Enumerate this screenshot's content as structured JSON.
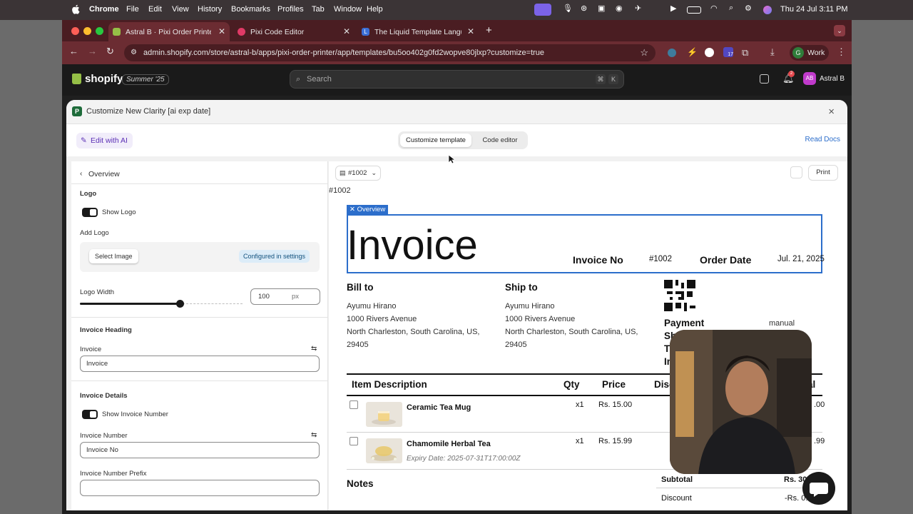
{
  "menubar": {
    "app": "Chrome",
    "items": [
      "File",
      "Edit",
      "View",
      "History",
      "Bookmarks",
      "Profiles",
      "Tab",
      "Window",
      "Help"
    ],
    "clock": "Thu 24 Jul  3:11 PM"
  },
  "browser": {
    "tabs": [
      {
        "title": "Astral B · Pixi Order Printer · S"
      },
      {
        "title": "Pixi Code Editor"
      },
      {
        "title": "The Liquid Template Languag"
      }
    ],
    "new_tab": "+",
    "url": "admin.shopify.com/store/astral-b/apps/pixi-order-printer/app/templates/bu5oo402g0fd2wopve80jlxp?customize=true",
    "profile_label": "Work",
    "profile_initial": "G",
    "ext_badge": "17"
  },
  "shopify": {
    "brand": "shopify",
    "edition": "Summer '25",
    "search_placeholder": "Search",
    "kbd1": "⌘",
    "kbd2": "K",
    "notif_count": "2",
    "store_initials": "AB",
    "store_name": "Astral B"
  },
  "app": {
    "title": "Customize New Clarity [ai exp date]",
    "ai_button": "Edit with AI",
    "tab_customize": "Customize template",
    "tab_code": "Code editor",
    "read_docs": "Read Docs",
    "close": "×"
  },
  "panel": {
    "back_label": "Overview",
    "logo_heading": "Logo",
    "show_logo": "Show Logo",
    "add_logo": "Add Logo",
    "select_image": "Select Image",
    "configured": "Configured in settings",
    "logo_width_label": "Logo Width",
    "logo_width_value": "100",
    "logo_width_unit": "px",
    "logo_width_fraction": 0.62,
    "invoice_heading_section": "Invoice Heading",
    "invoice_label": "Invoice",
    "invoice_value": "Invoice",
    "invoice_details_section": "Invoice Details",
    "show_invoice_number": "Show Invoice Number",
    "invoice_number_label": "Invoice Number",
    "invoice_number_value": "Invoice No",
    "invoice_prefix_label": "Invoice Number Prefix",
    "invoice_prefix_value": ""
  },
  "preview": {
    "order_selector": "#1002",
    "print": "Print",
    "order_text": "#1002",
    "overview_tag": "Overview",
    "invoice_title": "Invoice",
    "invoice_no_label": "Invoice No",
    "invoice_no_value": "#1002",
    "order_date_label": "Order Date",
    "order_date_value": "Jul. 21, 2025",
    "bill_to": {
      "title": "Bill to",
      "name": "Ayumu Hirano",
      "line1": "1000 Rivers Avenue",
      "line2": "North Charleston, South Carolina, US,",
      "line3": "29405"
    },
    "ship_to": {
      "title": "Ship to",
      "name": "Ayumu Hirano",
      "line1": "1000 Rivers Avenue",
      "line2": "North Charleston, South Carolina, US,",
      "line3": "29405"
    },
    "payment_label": "Payment",
    "payment_value": "manual",
    "shipping_label": "Shippi",
    "tracking_label": "Tra",
    "info_label": "In",
    "columns": {
      "desc": "Item Description",
      "qty": "Qty",
      "price": "Price",
      "discount": "Disc",
      "total": "al"
    },
    "items": [
      {
        "name": "Ceramic Tea Mug",
        "qty": "x1",
        "price": "Rs. 15.00",
        "total": ".00",
        "expiry": ""
      },
      {
        "name": "Chamomile Herbal Tea",
        "qty": "x1",
        "price": "Rs. 15.99",
        "total": ".99",
        "expiry": "Expiry Date: 2025-07-31T17:00:00Z"
      }
    ],
    "notes": "Notes",
    "subtotal_label": "Subtotal",
    "subtotal_value": "Rs. 30",
    "discount_label": "Discount",
    "discount_value": "-Rs. 0."
  }
}
